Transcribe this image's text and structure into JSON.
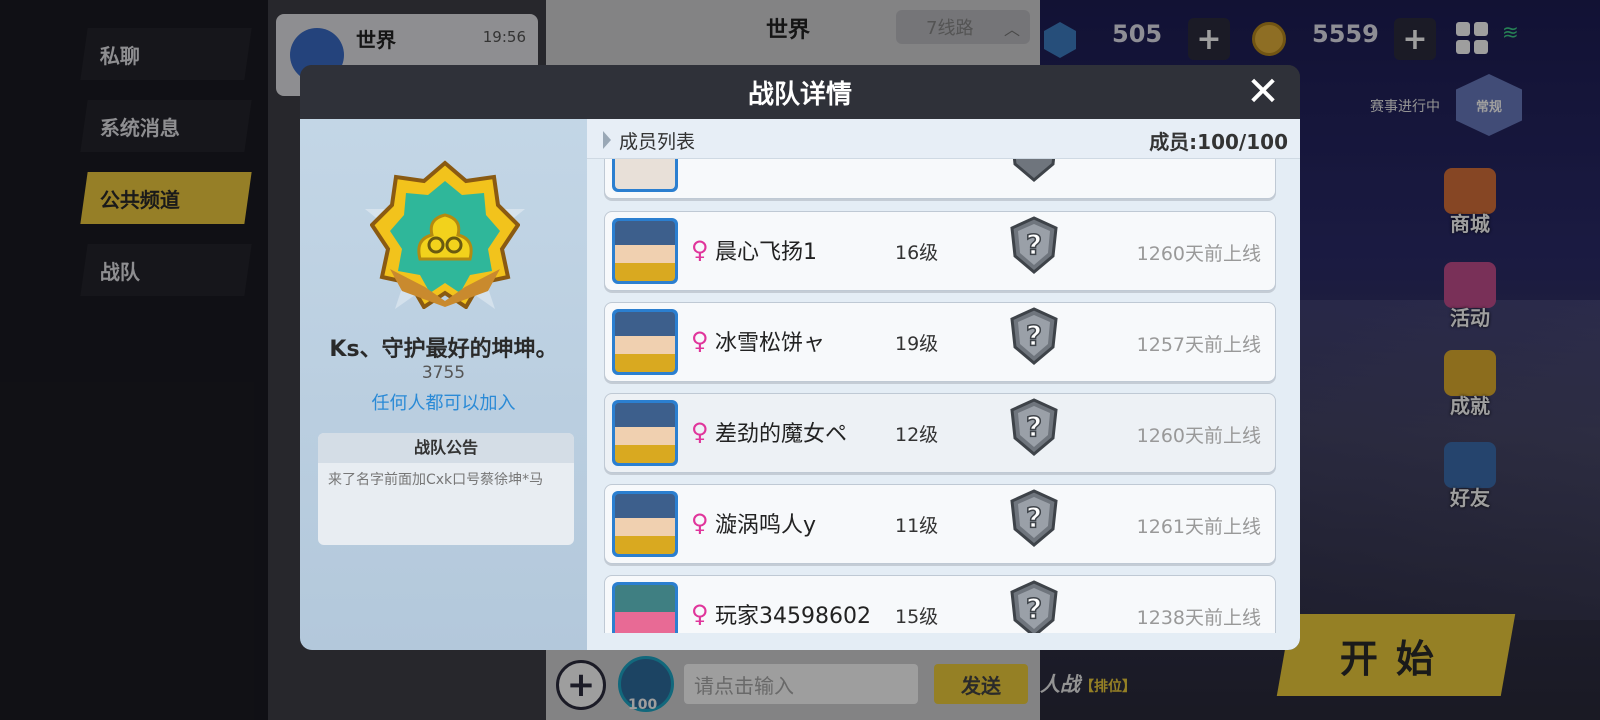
{
  "sidebar": {
    "tabs": [
      {
        "label": "私聊"
      },
      {
        "label": "系统消息"
      },
      {
        "label": "公共频道"
      },
      {
        "label": "战队"
      }
    ]
  },
  "chatlist": {
    "item": {
      "title": "世界",
      "time": "19:56"
    }
  },
  "chat": {
    "channel_title": "世界",
    "line_select": "7线路",
    "input_placeholder": "请点击输入",
    "send_label": "发送",
    "voice_count": "100"
  },
  "hud": {
    "gems": "505",
    "coins": "5559",
    "event_label": "赛事进行中",
    "event_badge": "常规",
    "side_buttons": [
      {
        "label": "商城",
        "icon": "shop-icon",
        "color": "#d9713a"
      },
      {
        "label": "活动",
        "icon": "event-icon",
        "color": "#c44e8f"
      },
      {
        "label": "成就",
        "icon": "trophy-icon",
        "color": "#e2b030"
      },
      {
        "label": "好友",
        "icon": "friends-icon",
        "color": "#3d6fb0"
      }
    ],
    "start_label": "开始",
    "mode_label": "人战",
    "mode_sub": "【排位】"
  },
  "modal": {
    "title": "战队详情",
    "team": {
      "name": "Ks、守护最好的坤坤。",
      "id": "3755",
      "join_policy": "任何人都可以加入",
      "notice_title": "战队公告",
      "notice_text": "来了名字前面加Cxk口号蔡徐坤*马"
    },
    "members_title": "成员列表",
    "members_count": "成员:100/100",
    "members": [
      {
        "name": "晨心飞扬1",
        "gender": "♀",
        "level": "16级",
        "last_online": "1260天前上线",
        "avatar": "blue"
      },
      {
        "name": "冰雪松饼ャ",
        "gender": "♀",
        "level": "19级",
        "last_online": "1257天前上线",
        "avatar": "blue"
      },
      {
        "name": "差劲的魔女ペ",
        "gender": "♀",
        "level": "12级",
        "last_online": "1260天前上线",
        "avatar": "blue"
      },
      {
        "name": "漩涡鸣人y",
        "gender": "♀",
        "level": "11级",
        "last_online": "1261天前上线",
        "avatar": "blue"
      },
      {
        "name": "玩家34598602",
        "gender": "♀",
        "level": "15级",
        "last_online": "1238天前上线",
        "avatar": "pink"
      }
    ]
  }
}
